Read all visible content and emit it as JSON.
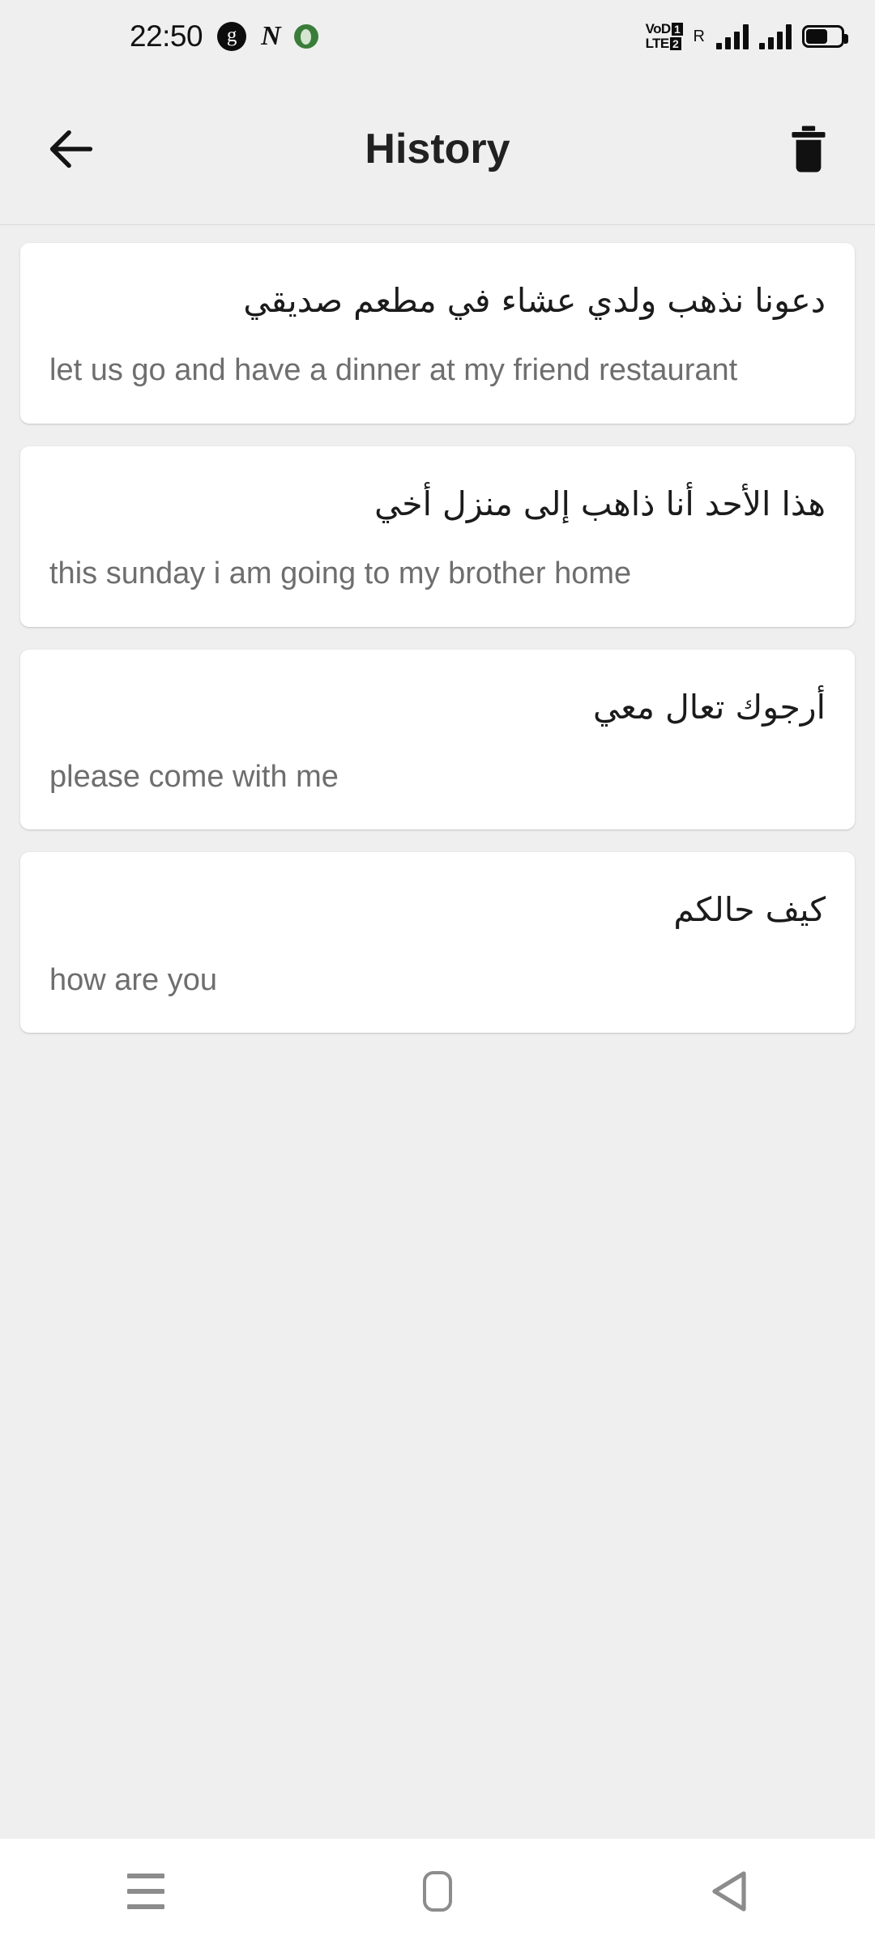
{
  "status_bar": {
    "clock": "22:50",
    "left_icons": [
      {
        "name": "grammarly-icon",
        "glyph": "g"
      },
      {
        "name": "nike-run-icon",
        "glyph": "N"
      },
      {
        "name": "green-app-icon",
        "glyph": ""
      }
    ],
    "volte_line1": "VoD",
    "volte_line2": "LTE",
    "volte_badge1": "1",
    "volte_badge2": "2",
    "roaming": "R",
    "signal_sim1_bars": 4,
    "signal_sim2_bars": 4,
    "battery_level": "60"
  },
  "app_bar": {
    "back_label": "Back",
    "title": "History",
    "delete_label": "Delete all history"
  },
  "history": {
    "items": [
      {
        "source": "دعونا نذهب ولدي عشاء في مطعم صديقي",
        "translation": "let us go and have a dinner at my friend restaurant"
      },
      {
        "source": "هذا الأحد أنا ذاهب إلى منزل أخي",
        "translation": "this sunday i am going to my brother home"
      },
      {
        "source": "أرجوك تعال معي",
        "translation": "please come with me"
      },
      {
        "source": "كيف حالكم",
        "translation": "how are you"
      }
    ]
  },
  "nav_bar": {
    "recents_label": "Recent apps",
    "home_label": "Home",
    "back_label": "Back"
  },
  "colors": {
    "background": "#efefef",
    "card": "#ffffff",
    "source_text": "#1b1b1b",
    "translation_text": "#6e6e6e",
    "title": "#212121",
    "nav_icon": "#8c8c8c"
  }
}
